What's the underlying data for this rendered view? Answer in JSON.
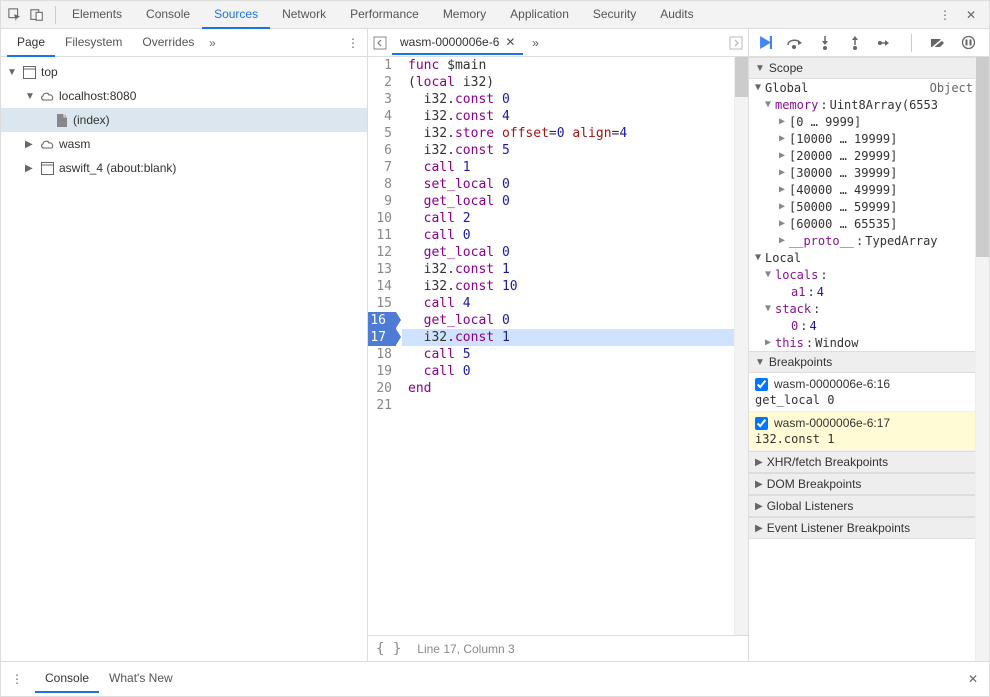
{
  "mainTabs": [
    "Elements",
    "Console",
    "Sources",
    "Network",
    "Performance",
    "Memory",
    "Application",
    "Security",
    "Audits"
  ],
  "mainActive": "Sources",
  "leftTabs": [
    "Page",
    "Filesystem",
    "Overrides"
  ],
  "leftActive": "Page",
  "tree": {
    "top": "top",
    "host": "localhost:8080",
    "index": "(index)",
    "wasm": "wasm",
    "blank": "aswift_4 (about:blank)"
  },
  "editorTab": "wasm-0000006e-6",
  "code": [
    {
      "n": 1,
      "raw": "func $main",
      "t": [
        [
          "func ",
          "kw-purple"
        ],
        [
          "$main",
          ""
        ]
      ]
    },
    {
      "n": 2,
      "raw": "(local i32)",
      "t": [
        [
          "(",
          ""
        ],
        [
          "local ",
          "kw-purple"
        ],
        [
          "i32",
          ""
        ],
        [
          ")",
          ""
        ]
      ]
    },
    {
      "n": 3,
      "raw": "  i32.const 0",
      "t": [
        [
          "  i32.",
          ""
        ],
        [
          "const ",
          "kw-purple"
        ],
        [
          "0",
          "kw-num"
        ]
      ]
    },
    {
      "n": 4,
      "raw": "  i32.const 4",
      "t": [
        [
          "  i32.",
          ""
        ],
        [
          "const ",
          "kw-purple"
        ],
        [
          "4",
          "kw-num"
        ]
      ]
    },
    {
      "n": 5,
      "raw": "  i32.store offset=0 align=4",
      "t": [
        [
          "  i32.",
          ""
        ],
        [
          "store ",
          "kw-purple"
        ],
        [
          "offset",
          "kw-red"
        ],
        [
          "=",
          ""
        ],
        [
          "0",
          "kw-num"
        ],
        [
          " ",
          ""
        ],
        [
          "align",
          "kw-red"
        ],
        [
          "=",
          ""
        ],
        [
          "4",
          "kw-num"
        ]
      ]
    },
    {
      "n": 6,
      "raw": "  i32.const 5",
      "t": [
        [
          "  i32.",
          ""
        ],
        [
          "const ",
          "kw-purple"
        ],
        [
          "5",
          "kw-num"
        ]
      ]
    },
    {
      "n": 7,
      "raw": "  call 1",
      "t": [
        [
          "  ",
          ""
        ],
        [
          "call ",
          "kw-purple"
        ],
        [
          "1",
          "kw-num"
        ]
      ]
    },
    {
      "n": 8,
      "raw": "  set_local 0",
      "t": [
        [
          "  ",
          ""
        ],
        [
          "set_local ",
          "kw-purple"
        ],
        [
          "0",
          "kw-num"
        ]
      ]
    },
    {
      "n": 9,
      "raw": "  get_local 0",
      "t": [
        [
          "  ",
          ""
        ],
        [
          "get_local ",
          "kw-purple"
        ],
        [
          "0",
          "kw-num"
        ]
      ]
    },
    {
      "n": 10,
      "raw": "  call 2",
      "t": [
        [
          "  ",
          ""
        ],
        [
          "call ",
          "kw-purple"
        ],
        [
          "2",
          "kw-num"
        ]
      ]
    },
    {
      "n": 11,
      "raw": "  call 0",
      "t": [
        [
          "  ",
          ""
        ],
        [
          "call ",
          "kw-purple"
        ],
        [
          "0",
          "kw-num"
        ]
      ]
    },
    {
      "n": 12,
      "raw": "  get_local 0",
      "t": [
        [
          "  ",
          ""
        ],
        [
          "get_local ",
          "kw-purple"
        ],
        [
          "0",
          "kw-num"
        ]
      ]
    },
    {
      "n": 13,
      "raw": "  i32.const 1",
      "t": [
        [
          "  i32.",
          ""
        ],
        [
          "const ",
          "kw-purple"
        ],
        [
          "1",
          "kw-num"
        ]
      ]
    },
    {
      "n": 14,
      "raw": "  i32.const 10",
      "t": [
        [
          "  i32.",
          ""
        ],
        [
          "const ",
          "kw-purple"
        ],
        [
          "10",
          "kw-num"
        ]
      ]
    },
    {
      "n": 15,
      "raw": "  call 4",
      "t": [
        [
          "  ",
          ""
        ],
        [
          "call ",
          "kw-purple"
        ],
        [
          "4",
          "kw-num"
        ]
      ]
    },
    {
      "n": 16,
      "raw": "  get_local 0",
      "bp": true,
      "t": [
        [
          "  ",
          ""
        ],
        [
          "get_local ",
          "kw-purple"
        ],
        [
          "0",
          "kw-num"
        ]
      ]
    },
    {
      "n": 17,
      "raw": "  i32.const 1",
      "bp": true,
      "hl": true,
      "t": [
        [
          "  i32.",
          ""
        ],
        [
          "const ",
          "kw-purple"
        ],
        [
          "1",
          "kw-num"
        ]
      ]
    },
    {
      "n": 18,
      "raw": "  call 5",
      "t": [
        [
          "  ",
          ""
        ],
        [
          "call ",
          "kw-purple"
        ],
        [
          "5",
          "kw-num"
        ]
      ]
    },
    {
      "n": 19,
      "raw": "  call 0",
      "t": [
        [
          "  ",
          ""
        ],
        [
          "call ",
          "kw-purple"
        ],
        [
          "0",
          "kw-num"
        ]
      ]
    },
    {
      "n": 20,
      "raw": "end",
      "t": [
        [
          "end",
          "kw-purple"
        ]
      ]
    },
    {
      "n": 21,
      "raw": "",
      "t": []
    }
  ],
  "status": "Line 17, Column 3",
  "scope": {
    "title": "Scope",
    "global": "Global",
    "globalType": "Object",
    "memory": "memory",
    "memoryType": "Uint8Array(6553",
    "ranges": [
      "[0 … 9999]",
      "[10000 … 19999]",
      "[20000 … 29999]",
      "[30000 … 39999]",
      "[40000 … 49999]",
      "[50000 … 59999]",
      "[60000 … 65535]"
    ],
    "proto": "__proto__",
    "protoType": "TypedArray",
    "local": "Local",
    "locals": "locals",
    "localsA1": "a1",
    "localsA1v": "4",
    "stack": "stack",
    "stack0": "0",
    "stack0v": "4",
    "this": "this",
    "thisType": "Window"
  },
  "breakpoints": {
    "title": "Breakpoints",
    "items": [
      {
        "file": "wasm-0000006e-6:16",
        "code": "get_local 0",
        "current": false
      },
      {
        "file": "wasm-0000006e-6:17",
        "code": "i32.const 1",
        "current": true
      }
    ]
  },
  "collapsedSections": [
    "XHR/fetch Breakpoints",
    "DOM Breakpoints",
    "Global Listeners",
    "Event Listener Breakpoints"
  ],
  "drawerTabs": [
    "Console",
    "What's New"
  ],
  "drawerActive": "Console"
}
